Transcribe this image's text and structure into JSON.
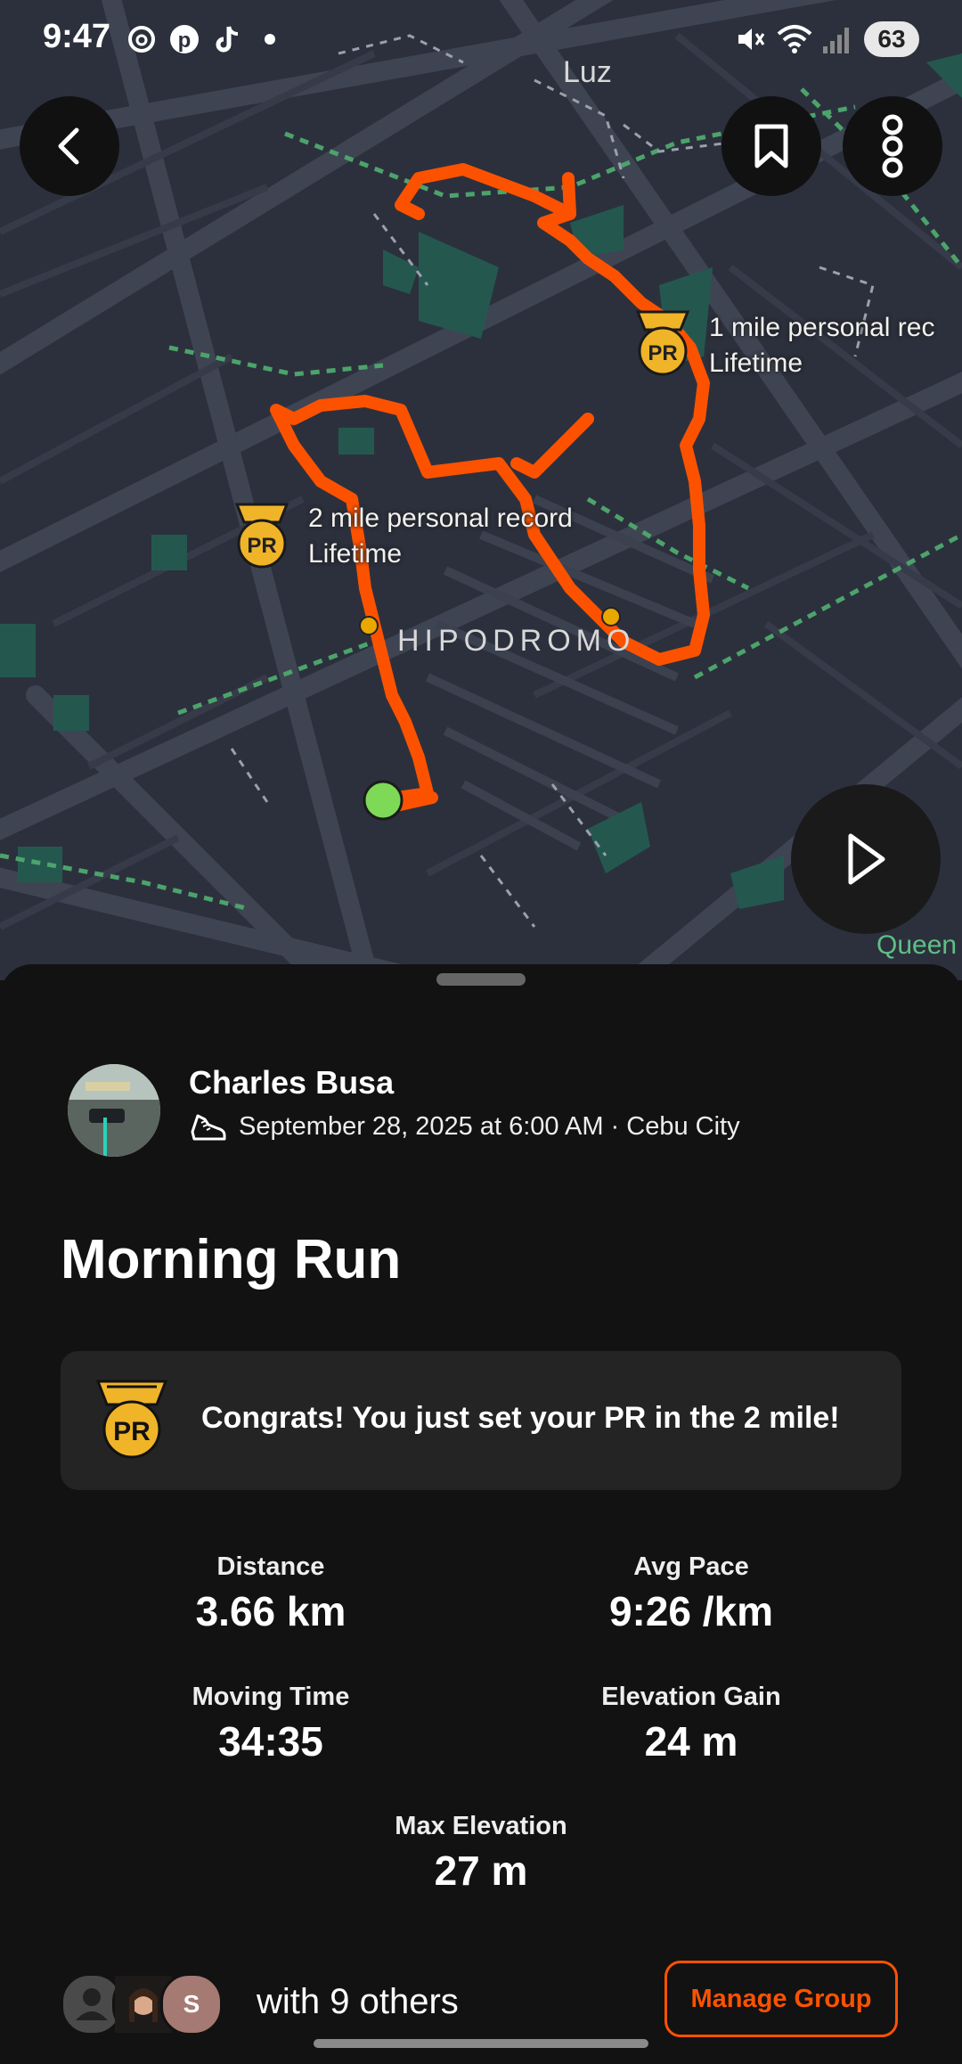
{
  "status_bar": {
    "time": "9:47",
    "battery": "63",
    "left_icons": [
      "threads-icon",
      "pinterest-icon",
      "tiktok-icon",
      "dot-icon"
    ],
    "right_icons": [
      "mute-icon",
      "wifi-icon",
      "signal-icon"
    ]
  },
  "map": {
    "area_labels": {
      "top": "Luz",
      "center": "HIPODROMO",
      "bottom_right": "Queen"
    },
    "pr_markers": [
      {
        "line1": "1 mile personal rec",
        "line2": "Lifetime",
        "badge": "PR"
      },
      {
        "line1": "2 mile personal record",
        "line2": "Lifetime",
        "badge": "PR"
      }
    ],
    "route_color": "#fc5200",
    "start_marker_color": "#7ed957",
    "split_marker_color": "#e8a800"
  },
  "activity": {
    "athlete": "Charles Busa",
    "meta": "September 28, 2025 at 6:00 AM · Cebu City",
    "sport_icon": "run-shoe-icon",
    "title": "Morning Run",
    "pr_message": "Congrats! You just set your PR in the 2 mile!",
    "pr_badge": "PR",
    "stats": {
      "distance": {
        "label": "Distance",
        "value": "3.66 km"
      },
      "avg_pace": {
        "label": "Avg Pace",
        "value": "9:26 /km"
      },
      "moving_time": {
        "label": "Moving Time",
        "value": "34:35"
      },
      "elevation_gain": {
        "label": "Elevation Gain",
        "value": "24 m"
      },
      "max_elevation": {
        "label": "Max Elevation",
        "value": "27 m"
      }
    },
    "group": {
      "text": "with 9 others",
      "avatar_initial": "S",
      "manage_label": "Manage Group"
    }
  },
  "colors": {
    "accent": "#fc5200",
    "pr_gold": "#f0b429",
    "background": "#121212",
    "card": "#242424"
  }
}
